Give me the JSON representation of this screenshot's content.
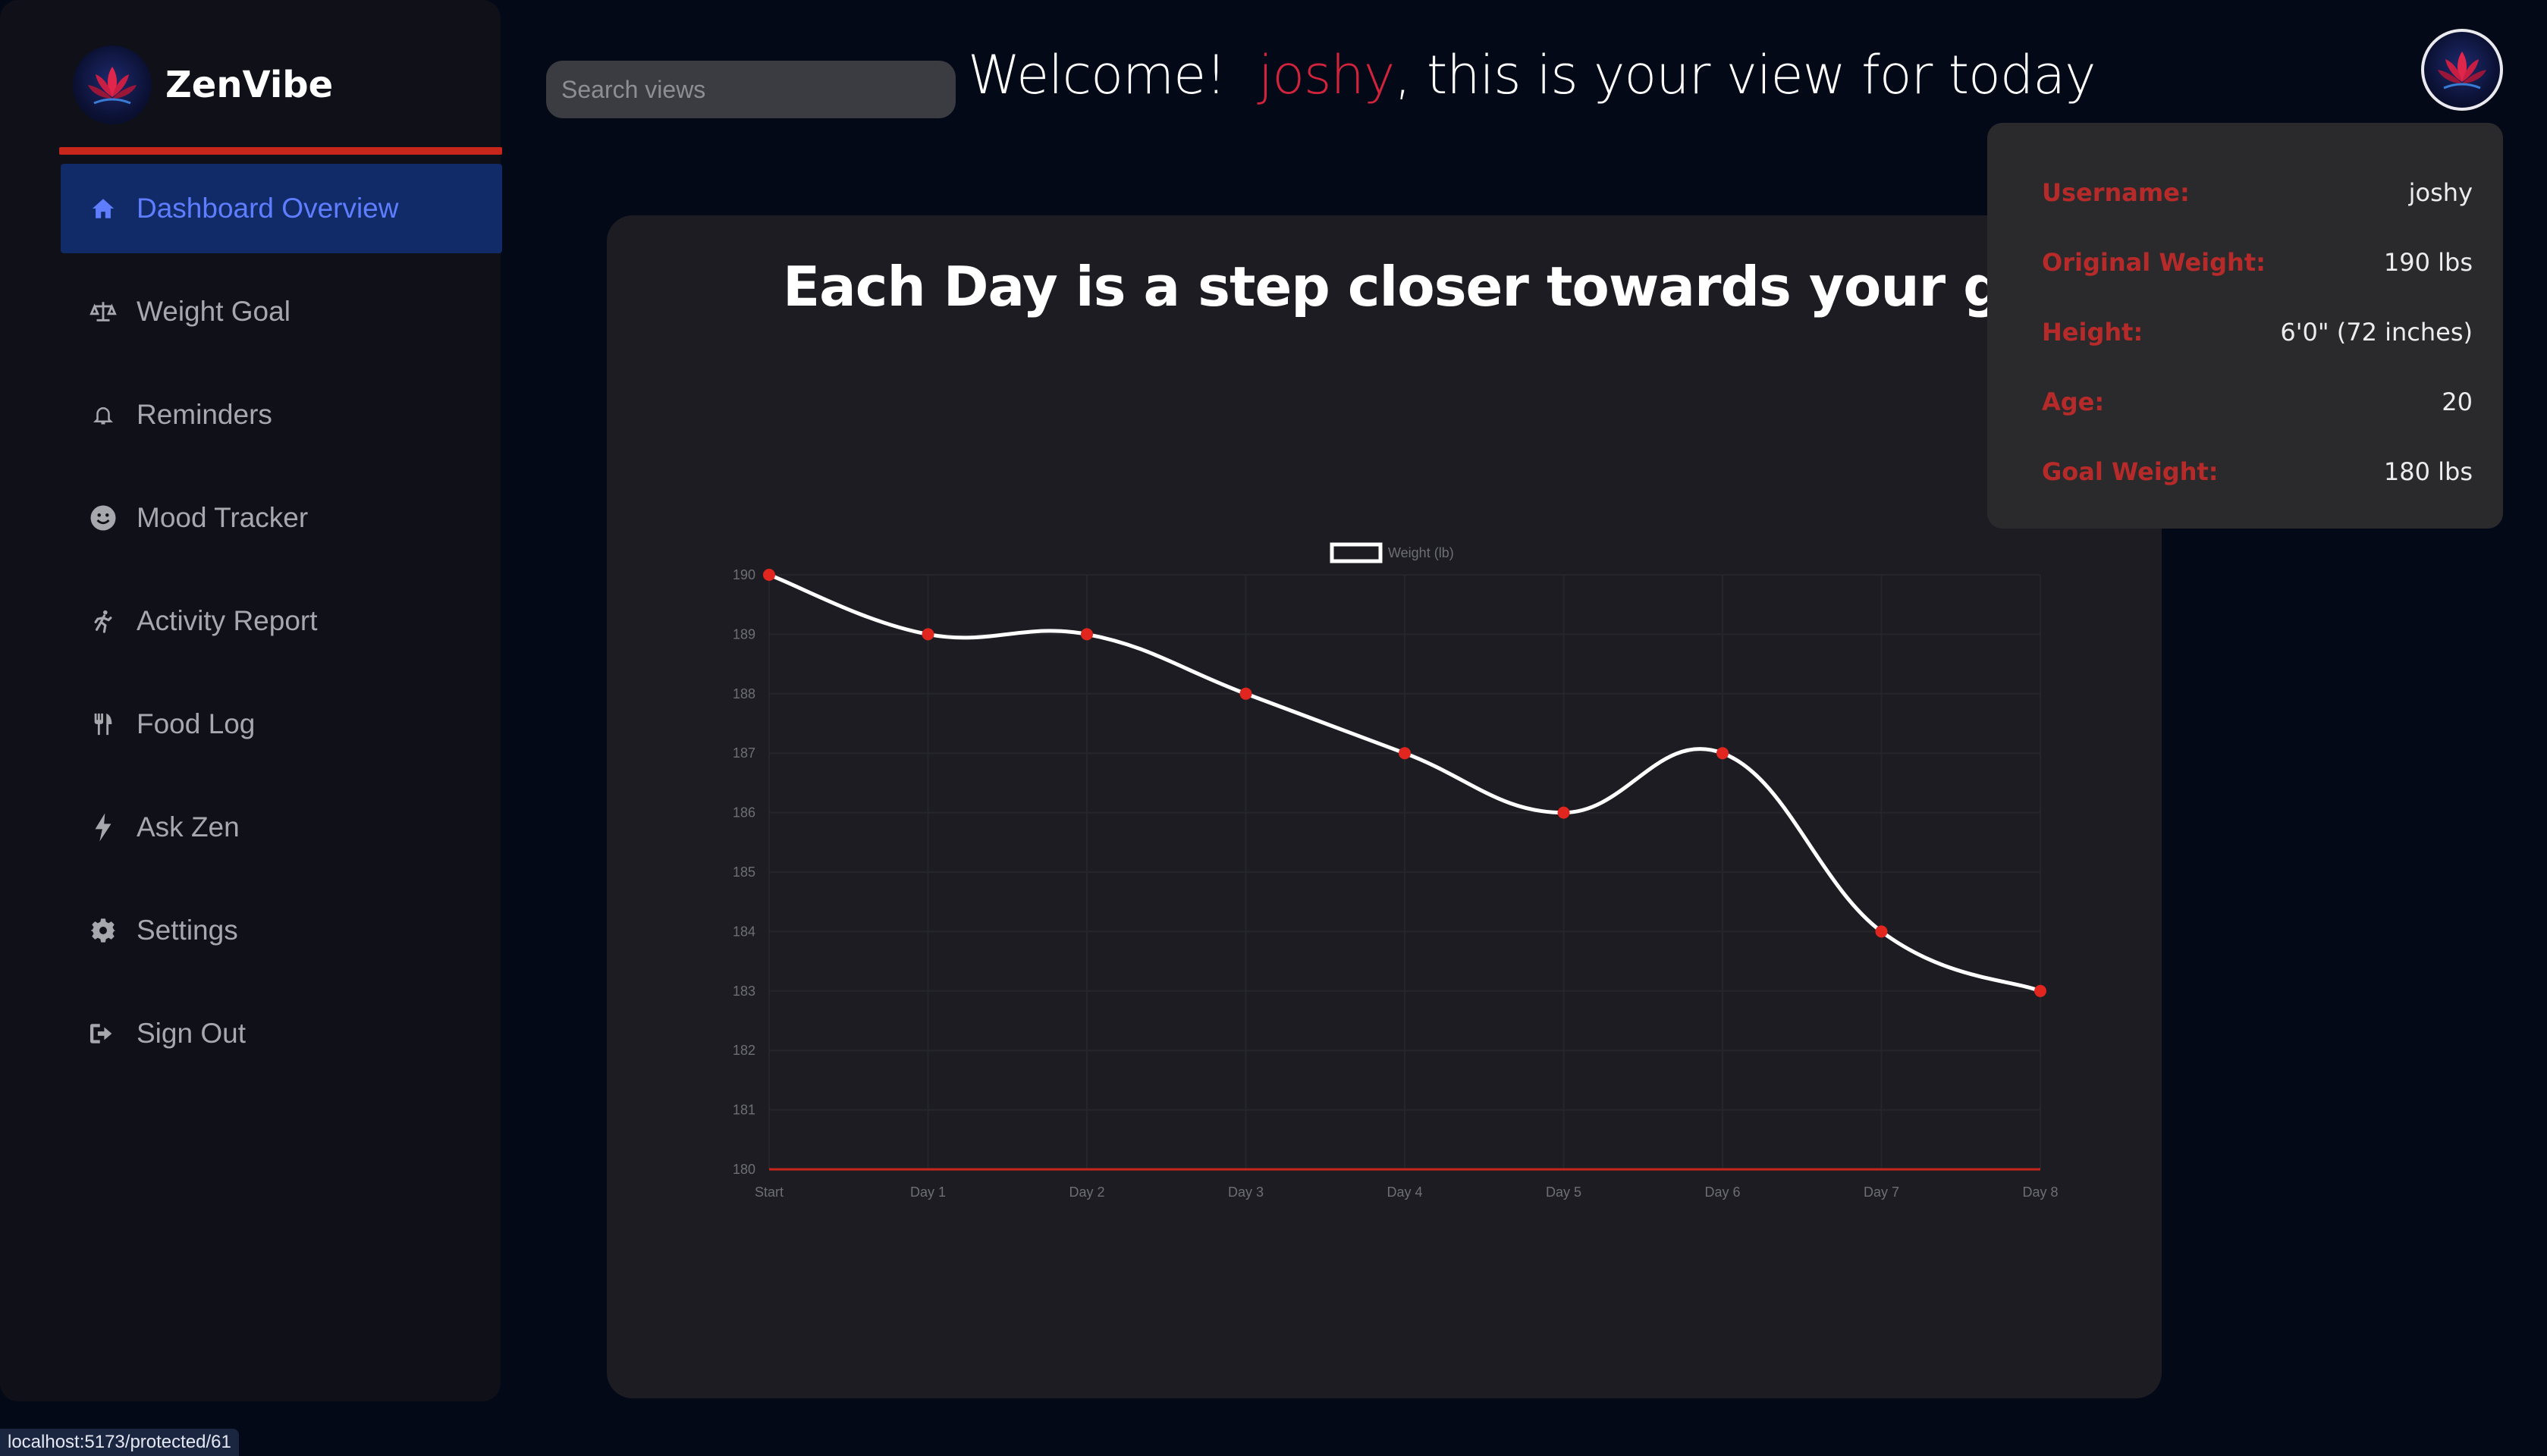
{
  "app": {
    "name": "ZenVibe",
    "logo_icon": "lotus-icon"
  },
  "colors": {
    "accent_red": "#c8261a",
    "active_nav_bg": "#112a68",
    "active_nav_text": "#5e7dff",
    "username_red": "#d1243c"
  },
  "sidebar": {
    "items": [
      {
        "label": "Dashboard Overview",
        "icon": "home-icon",
        "active": true
      },
      {
        "label": "Weight Goal",
        "icon": "scale-icon"
      },
      {
        "label": "Reminders",
        "icon": "bell-icon"
      },
      {
        "label": "Mood Tracker",
        "icon": "smiley-icon"
      },
      {
        "label": "Activity Report",
        "icon": "running-icon"
      },
      {
        "label": "Food Log",
        "icon": "utensils-icon"
      },
      {
        "label": "Ask Zen",
        "icon": "lightning-icon"
      },
      {
        "label": "Settings",
        "icon": "gear-icon"
      },
      {
        "label": "Sign Out",
        "icon": "sign-out-icon"
      }
    ]
  },
  "header": {
    "search_placeholder": "Search views",
    "welcome_prefix": "Welcome!",
    "username": "joshy",
    "welcome_suffix": ", this is your view for today"
  },
  "profile": {
    "rows": [
      {
        "label": "Username:",
        "value": "joshy"
      },
      {
        "label": "Original Weight:",
        "value": "190 lbs"
      },
      {
        "label": "Height:",
        "value": "6'0\" (72 inches)"
      },
      {
        "label": "Age:",
        "value": "20"
      },
      {
        "label": "Goal Weight:",
        "value": "180 lbs"
      }
    ]
  },
  "main": {
    "title": "Each Day is a step closer towards your goals"
  },
  "chart_data": {
    "type": "line",
    "categories": [
      "Start",
      "Day 1",
      "Day 2",
      "Day 3",
      "Day 4",
      "Day 5",
      "Day 6",
      "Day 7",
      "Day 8"
    ],
    "series": [
      {
        "name": "Weight (lb)",
        "values": [
          190,
          189,
          189,
          188,
          187,
          186,
          187,
          184,
          183
        ],
        "color": "#ffffff",
        "point_color": "#e0261e"
      }
    ],
    "goal_line": {
      "value": 180,
      "color": "#c8261a"
    },
    "yticks": [
      190,
      189,
      188,
      187,
      186,
      185,
      184,
      183,
      182,
      181,
      180
    ],
    "ylim": [
      180,
      190
    ],
    "legend": "top-center",
    "grid": true
  },
  "statusbar": {
    "url": "localhost:5173/protected/61"
  }
}
